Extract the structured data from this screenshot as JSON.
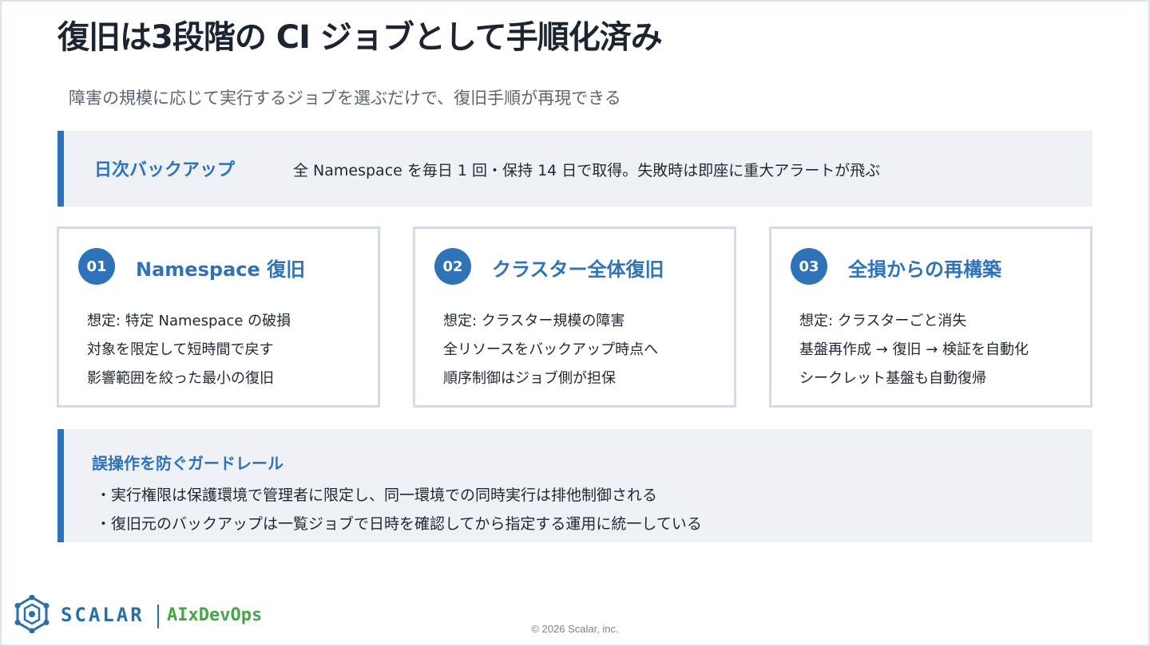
{
  "title": "復旧は3段階の CI ジョブとして手順化済み",
  "subtitle": "障害の規模に応じて実行するジョブを選ぶだけで、復旧手順が再現できる",
  "daily_backup": {
    "label": "日次バックアップ",
    "text": "全 Namespace を毎日 1 回・保持 14 日で取得。失敗時は即座に重大アラートが飛ぶ"
  },
  "cards": [
    {
      "num": "01",
      "title": "Namespace 復旧",
      "lines": [
        "想定: 特定 Namespace の破損",
        "対象を限定して短時間で戻す",
        "影響範囲を絞った最小の復旧"
      ]
    },
    {
      "num": "02",
      "title": "クラスター全体復旧",
      "lines": [
        "想定: クラスター規模の障害",
        "全リソースをバックアップ時点へ",
        "順序制御はジョブ側が担保"
      ]
    },
    {
      "num": "03",
      "title": "全損からの再構築",
      "lines": [
        "想定: クラスターごと消失",
        "基盤再作成 → 復旧 → 検証を自動化",
        "シークレット基盤も自動復帰"
      ]
    }
  ],
  "guardrail": {
    "title": "誤操作を防ぐガードレール",
    "items": [
      "・実行権限は保護環境で管理者に限定し、同一環境での同時実行は排他制御される",
      "・復旧元のバックアップは一覧ジョブで日時を確認してから指定する運用に統一している"
    ]
  },
  "footer": {
    "brand": "SCALAR",
    "sub_brand": "AIxDevOps",
    "copyright": "© 2026 Scalar, inc.",
    "logo_icon": "scalar-hexagon-logo-icon"
  },
  "colors": {
    "accent": "#2e72b8",
    "panel": "#eef2f7",
    "border": "#d3dcea",
    "sub_brand": "#4aa54a"
  }
}
